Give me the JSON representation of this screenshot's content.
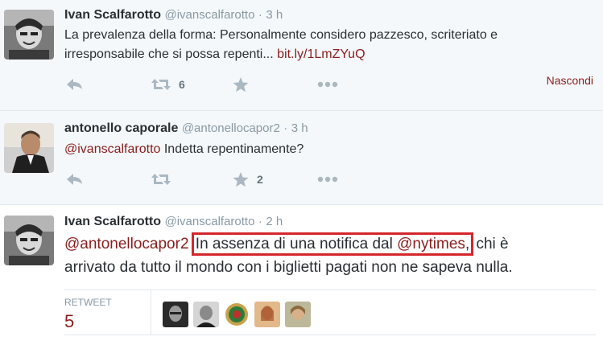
{
  "tweets": [
    {
      "name": "Ivan Scalfarotto",
      "handle": "@ivanscalfarotto",
      "sep": "·",
      "time": "3 h",
      "text_line1": "La prevalenza della forma: Personalmente considero pazzesco, scriteriato e",
      "text_line2": "irresponsabile che si possa repenti... ",
      "link": "bit.ly/1LmZYuQ",
      "retweets": "6",
      "hide_label": "Nascondi"
    },
    {
      "name": "antonello caporale",
      "handle": "@antonellocapor2",
      "sep": "·",
      "time": "3 h",
      "mention": "@ivanscalfarotto",
      "text": " Indetta repentinamente?",
      "favorites": "2"
    },
    {
      "name": "Ivan Scalfarotto",
      "handle": "@ivanscalfarotto",
      "sep": "·",
      "time": "2 h",
      "mention": "@antonellocapor2",
      "highlight_text": "In assenza di una notifica dal ",
      "highlight_mention": "@nytimes",
      "highlight_comma": ",",
      "text_rest": " chi è",
      "text_line2": "arrivato da tutto il mondo con i biglietti pagati non ne sapeva nulla.",
      "retweet_label": "RETWEET",
      "retweet_count": "5"
    }
  ],
  "colors": {
    "link": "#8a1d1d",
    "highlight_border": "#d4262b",
    "muted": "#8899a6"
  },
  "icons": [
    "reply-icon",
    "retweet-icon",
    "favorite-icon",
    "more-icon"
  ]
}
